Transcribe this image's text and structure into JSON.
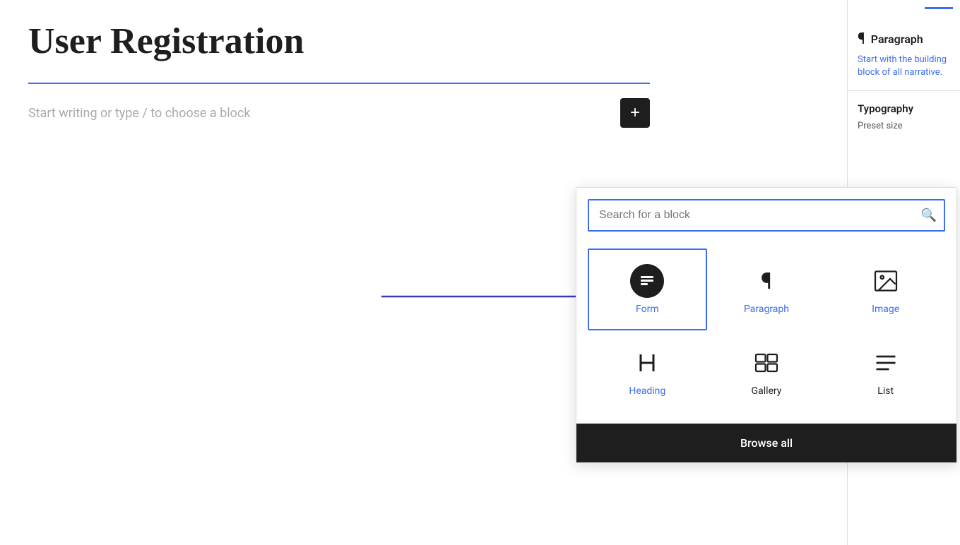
{
  "page": {
    "title": "User Registration",
    "placeholder": "Start writing or type / to choose a block",
    "add_button_label": "+"
  },
  "right_panel": {
    "paragraph_label": "Paragraph",
    "paragraph_desc": "Start with the building block of all narrative.",
    "typography_label": "Typography",
    "preset_size_label": "Preset size"
  },
  "block_picker": {
    "search_placeholder": "Search for a block",
    "blocks": [
      {
        "id": "form",
        "label": "Form",
        "type": "form"
      },
      {
        "id": "paragraph",
        "label": "Paragraph",
        "type": "pilcrow"
      },
      {
        "id": "image",
        "label": "Image",
        "type": "image"
      },
      {
        "id": "heading",
        "label": "Heading",
        "type": "heading"
      },
      {
        "id": "gallery",
        "label": "Gallery",
        "type": "gallery"
      },
      {
        "id": "list",
        "label": "List",
        "type": "list"
      }
    ],
    "browse_all_label": "Browse all"
  },
  "colors": {
    "accent_blue": "#3b6ef0",
    "dark": "#1e1e1e"
  }
}
